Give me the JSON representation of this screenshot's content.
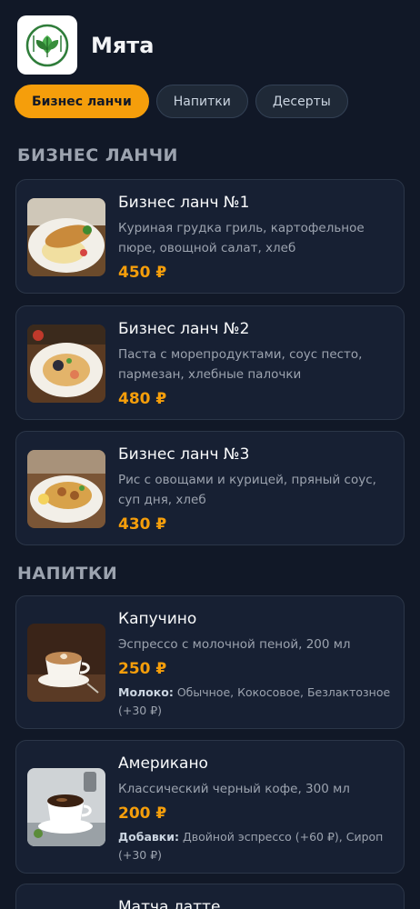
{
  "app": {
    "title": "Мята"
  },
  "tabs": [
    {
      "label": "Бизнес ланчи",
      "active": true
    },
    {
      "label": "Напитки",
      "active": false
    },
    {
      "label": "Десерты",
      "active": false
    }
  ],
  "sections": {
    "lunches": {
      "title": "БИЗНЕС ЛАНЧИ"
    },
    "drinks": {
      "title": "НАПИТКИ"
    }
  },
  "lunches": [
    {
      "name": "Бизнес ланч №1",
      "desc": "Куриная грудка гриль, картофельное пюре, овощной салат, хлеб",
      "price": "450 ₽"
    },
    {
      "name": "Бизнес ланч №2",
      "desc": "Паста с морепродуктами, соус песто, пармезан, хлебные палочки",
      "price": "480 ₽"
    },
    {
      "name": "Бизнес ланч №3",
      "desc": "Рис с овощами и курицей, пряный соус, суп дня, хлеб",
      "price": "430 ₽"
    }
  ],
  "drinks": [
    {
      "name": "Капучино",
      "desc": "Эспрессо с молочной пеной, 200 мл",
      "price": "250 ₽",
      "opt_label": "Молоко:",
      "opt_text": " Обычное, Кокосовое, Безлактозное (+30 ₽)"
    },
    {
      "name": "Американо",
      "desc": "Классический черный кофе, 300 мл",
      "price": "200 ₽",
      "opt_label": "Добавки:",
      "opt_text": " Двойной эспрессо (+60 ₽), Сироп (+30 ₽)"
    },
    {
      "name": "Матча латте"
    }
  ],
  "colors": {
    "accent": "#f59e0b",
    "background": "#111827",
    "card": "#172033"
  }
}
